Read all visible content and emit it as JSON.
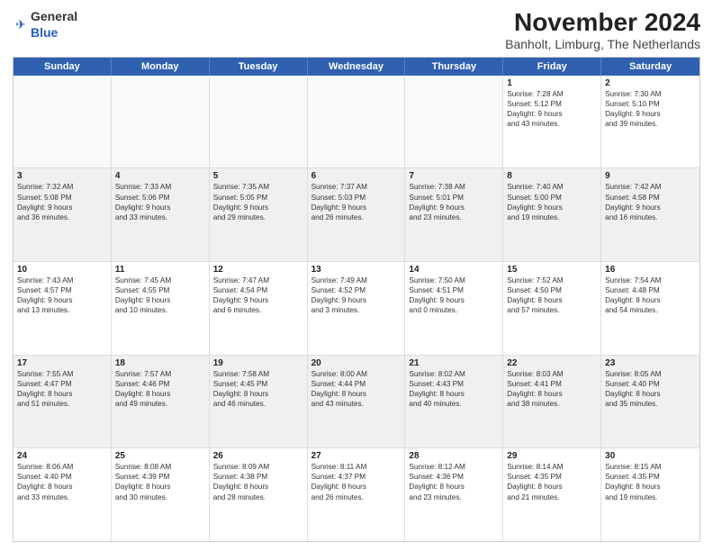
{
  "header": {
    "logo_general": "General",
    "logo_blue": "Blue",
    "title": "November 2024",
    "subtitle": "Banholt, Limburg, The Netherlands"
  },
  "days": [
    "Sunday",
    "Monday",
    "Tuesday",
    "Wednesday",
    "Thursday",
    "Friday",
    "Saturday"
  ],
  "weeks": [
    [
      {
        "day": "",
        "text": "",
        "empty": true
      },
      {
        "day": "",
        "text": "",
        "empty": true
      },
      {
        "day": "",
        "text": "",
        "empty": true
      },
      {
        "day": "",
        "text": "",
        "empty": true
      },
      {
        "day": "",
        "text": "",
        "empty": true
      },
      {
        "day": "1",
        "text": "Sunrise: 7:28 AM\nSunset: 5:12 PM\nDaylight: 9 hours\nand 43 minutes."
      },
      {
        "day": "2",
        "text": "Sunrise: 7:30 AM\nSunset: 5:10 PM\nDaylight: 9 hours\nand 39 minutes."
      }
    ],
    [
      {
        "day": "3",
        "text": "Sunrise: 7:32 AM\nSunset: 5:08 PM\nDaylight: 9 hours\nand 36 minutes."
      },
      {
        "day": "4",
        "text": "Sunrise: 7:33 AM\nSunset: 5:06 PM\nDaylight: 9 hours\nand 33 minutes."
      },
      {
        "day": "5",
        "text": "Sunrise: 7:35 AM\nSunset: 5:05 PM\nDaylight: 9 hours\nand 29 minutes."
      },
      {
        "day": "6",
        "text": "Sunrise: 7:37 AM\nSunset: 5:03 PM\nDaylight: 9 hours\nand 26 minutes."
      },
      {
        "day": "7",
        "text": "Sunrise: 7:38 AM\nSunset: 5:01 PM\nDaylight: 9 hours\nand 23 minutes."
      },
      {
        "day": "8",
        "text": "Sunrise: 7:40 AM\nSunset: 5:00 PM\nDaylight: 9 hours\nand 19 minutes."
      },
      {
        "day": "9",
        "text": "Sunrise: 7:42 AM\nSunset: 4:58 PM\nDaylight: 9 hours\nand 16 minutes."
      }
    ],
    [
      {
        "day": "10",
        "text": "Sunrise: 7:43 AM\nSunset: 4:57 PM\nDaylight: 9 hours\nand 13 minutes."
      },
      {
        "day": "11",
        "text": "Sunrise: 7:45 AM\nSunset: 4:55 PM\nDaylight: 9 hours\nand 10 minutes."
      },
      {
        "day": "12",
        "text": "Sunrise: 7:47 AM\nSunset: 4:54 PM\nDaylight: 9 hours\nand 6 minutes."
      },
      {
        "day": "13",
        "text": "Sunrise: 7:49 AM\nSunset: 4:52 PM\nDaylight: 9 hours\nand 3 minutes."
      },
      {
        "day": "14",
        "text": "Sunrise: 7:50 AM\nSunset: 4:51 PM\nDaylight: 9 hours\nand 0 minutes."
      },
      {
        "day": "15",
        "text": "Sunrise: 7:52 AM\nSunset: 4:50 PM\nDaylight: 8 hours\nand 57 minutes."
      },
      {
        "day": "16",
        "text": "Sunrise: 7:54 AM\nSunset: 4:48 PM\nDaylight: 8 hours\nand 54 minutes."
      }
    ],
    [
      {
        "day": "17",
        "text": "Sunrise: 7:55 AM\nSunset: 4:47 PM\nDaylight: 8 hours\nand 51 minutes."
      },
      {
        "day": "18",
        "text": "Sunrise: 7:57 AM\nSunset: 4:46 PM\nDaylight: 8 hours\nand 49 minutes."
      },
      {
        "day": "19",
        "text": "Sunrise: 7:58 AM\nSunset: 4:45 PM\nDaylight: 8 hours\nand 46 minutes."
      },
      {
        "day": "20",
        "text": "Sunrise: 8:00 AM\nSunset: 4:44 PM\nDaylight: 8 hours\nand 43 minutes."
      },
      {
        "day": "21",
        "text": "Sunrise: 8:02 AM\nSunset: 4:43 PM\nDaylight: 8 hours\nand 40 minutes."
      },
      {
        "day": "22",
        "text": "Sunrise: 8:03 AM\nSunset: 4:41 PM\nDaylight: 8 hours\nand 38 minutes."
      },
      {
        "day": "23",
        "text": "Sunrise: 8:05 AM\nSunset: 4:40 PM\nDaylight: 8 hours\nand 35 minutes."
      }
    ],
    [
      {
        "day": "24",
        "text": "Sunrise: 8:06 AM\nSunset: 4:40 PM\nDaylight: 8 hours\nand 33 minutes."
      },
      {
        "day": "25",
        "text": "Sunrise: 8:08 AM\nSunset: 4:39 PM\nDaylight: 8 hours\nand 30 minutes."
      },
      {
        "day": "26",
        "text": "Sunrise: 8:09 AM\nSunset: 4:38 PM\nDaylight: 8 hours\nand 28 minutes."
      },
      {
        "day": "27",
        "text": "Sunrise: 8:11 AM\nSunset: 4:37 PM\nDaylight: 8 hours\nand 26 minutes."
      },
      {
        "day": "28",
        "text": "Sunrise: 8:12 AM\nSunset: 4:36 PM\nDaylight: 8 hours\nand 23 minutes."
      },
      {
        "day": "29",
        "text": "Sunrise: 8:14 AM\nSunset: 4:35 PM\nDaylight: 8 hours\nand 21 minutes."
      },
      {
        "day": "30",
        "text": "Sunrise: 8:15 AM\nSunset: 4:35 PM\nDaylight: 8 hours\nand 19 minutes."
      }
    ]
  ]
}
